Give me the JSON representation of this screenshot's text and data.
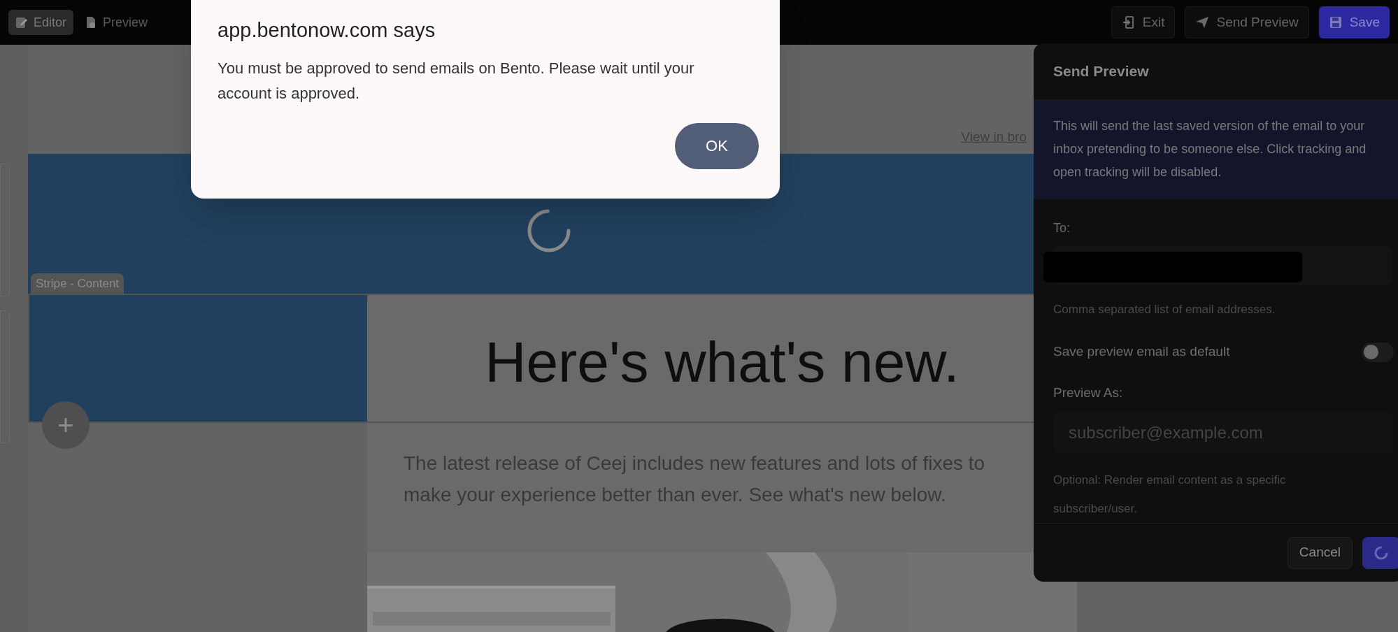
{
  "toolbar": {
    "left": [
      {
        "label": "Editor",
        "selected": true
      },
      {
        "label": "Preview",
        "selected": false
      }
    ],
    "right": [
      {
        "label": "Exit",
        "kind": "plain"
      },
      {
        "label": "Send Preview",
        "kind": "plain"
      },
      {
        "label": "Save",
        "kind": "primary"
      }
    ]
  },
  "alert": {
    "title": "app.bentonow.com says",
    "message": "You must be approved to send emails on Bento. Please wait until your account is approved.",
    "button": "OK"
  },
  "canvas": {
    "view_link": "View in bro",
    "stripe_tag": "Stripe - Content",
    "add_button": "+",
    "heading": "Here's what's new.",
    "body": "The latest release of Ceej includes new features and lots of fixes to make your experience better than ever. See what's new below.",
    "loading": true
  },
  "send_preview": {
    "title": "Send Preview",
    "info": "This will send the last saved version of the email to your inbox pretending to be someone else. Click tracking and open tracking will be disabled.",
    "to_label": "To:",
    "to_redacted": true,
    "to_hint": "Comma separated list of email addresses.",
    "toggle_label": "Save preview email as default",
    "toggle_on": false,
    "preview_as_label": "Preview As:",
    "preview_as_placeholder": "subscriber@example.com",
    "preview_as_hint": "Optional: Render email content as a specific subscriber/user.",
    "cancel": "Cancel",
    "sending": true
  }
}
